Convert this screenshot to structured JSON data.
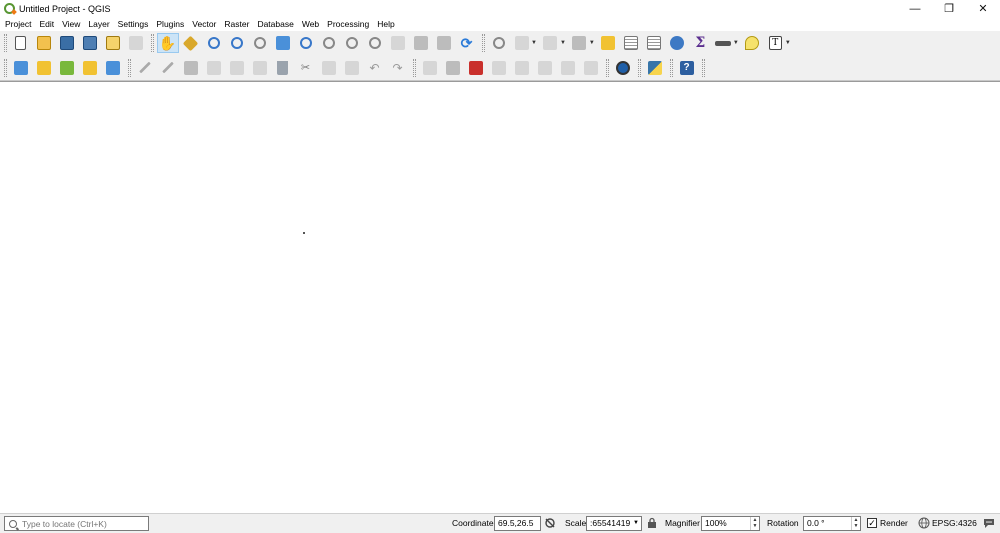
{
  "window": {
    "title": "Untitled Project - QGIS",
    "controls": [
      "—",
      "❐",
      "✕"
    ]
  },
  "menu": [
    "Project",
    "Edit",
    "View",
    "Layer",
    "Settings",
    "Plugins",
    "Vector",
    "Raster",
    "Database",
    "Web",
    "Processing",
    "Help"
  ],
  "toolbar1": {
    "text_tool_label": "T"
  },
  "status": {
    "locate_placeholder": "Type to locate (Ctrl+K)",
    "coordinate_label": "Coordinate",
    "coordinate_value": "69.5,26.5",
    "scale_label": "Scale",
    "scale_value": ":65541419",
    "magnifier_label": "Magnifier",
    "magnifier_value": "100%",
    "rotation_label": "Rotation",
    "rotation_value": "0.0 °",
    "render_label": "Render",
    "render_checked": true,
    "crs_label": "EPSG:4326"
  },
  "colors": {
    "qgis_green": "#589632",
    "active_tool_bg": "#cce4f7",
    "canvas_bg": "#ffffff"
  }
}
